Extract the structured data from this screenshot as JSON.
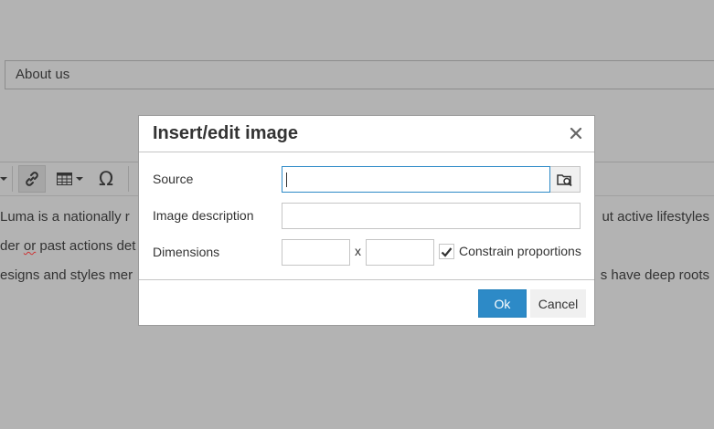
{
  "background": {
    "title_field_value": "About us",
    "content_lines": [
      {
        "left": "Luma is a nationally r",
        "right": "ut active lifestyles"
      },
      {
        "left_pre": "der ",
        "left_spell": "or",
        "left_post": " past actions det",
        "right": ""
      },
      {
        "left": "esigns and styles mer",
        "right": "s have deep roots"
      }
    ],
    "toolbar_icons": [
      "link-icon",
      "table-icon",
      "omega-icon"
    ]
  },
  "dialog": {
    "title": "Insert/edit image",
    "source_label": "Source",
    "source_value": "",
    "description_label": "Image description",
    "description_value": "",
    "dimensions_label": "Dimensions",
    "width_value": "",
    "height_value": "",
    "dimension_separator": "x",
    "constrain_label": "Constrain proportions",
    "constrain_checked": true,
    "ok_label": "Ok",
    "cancel_label": "Cancel"
  },
  "colors": {
    "overlay": "#b3b3b3",
    "accent": "#2d8ac7"
  }
}
